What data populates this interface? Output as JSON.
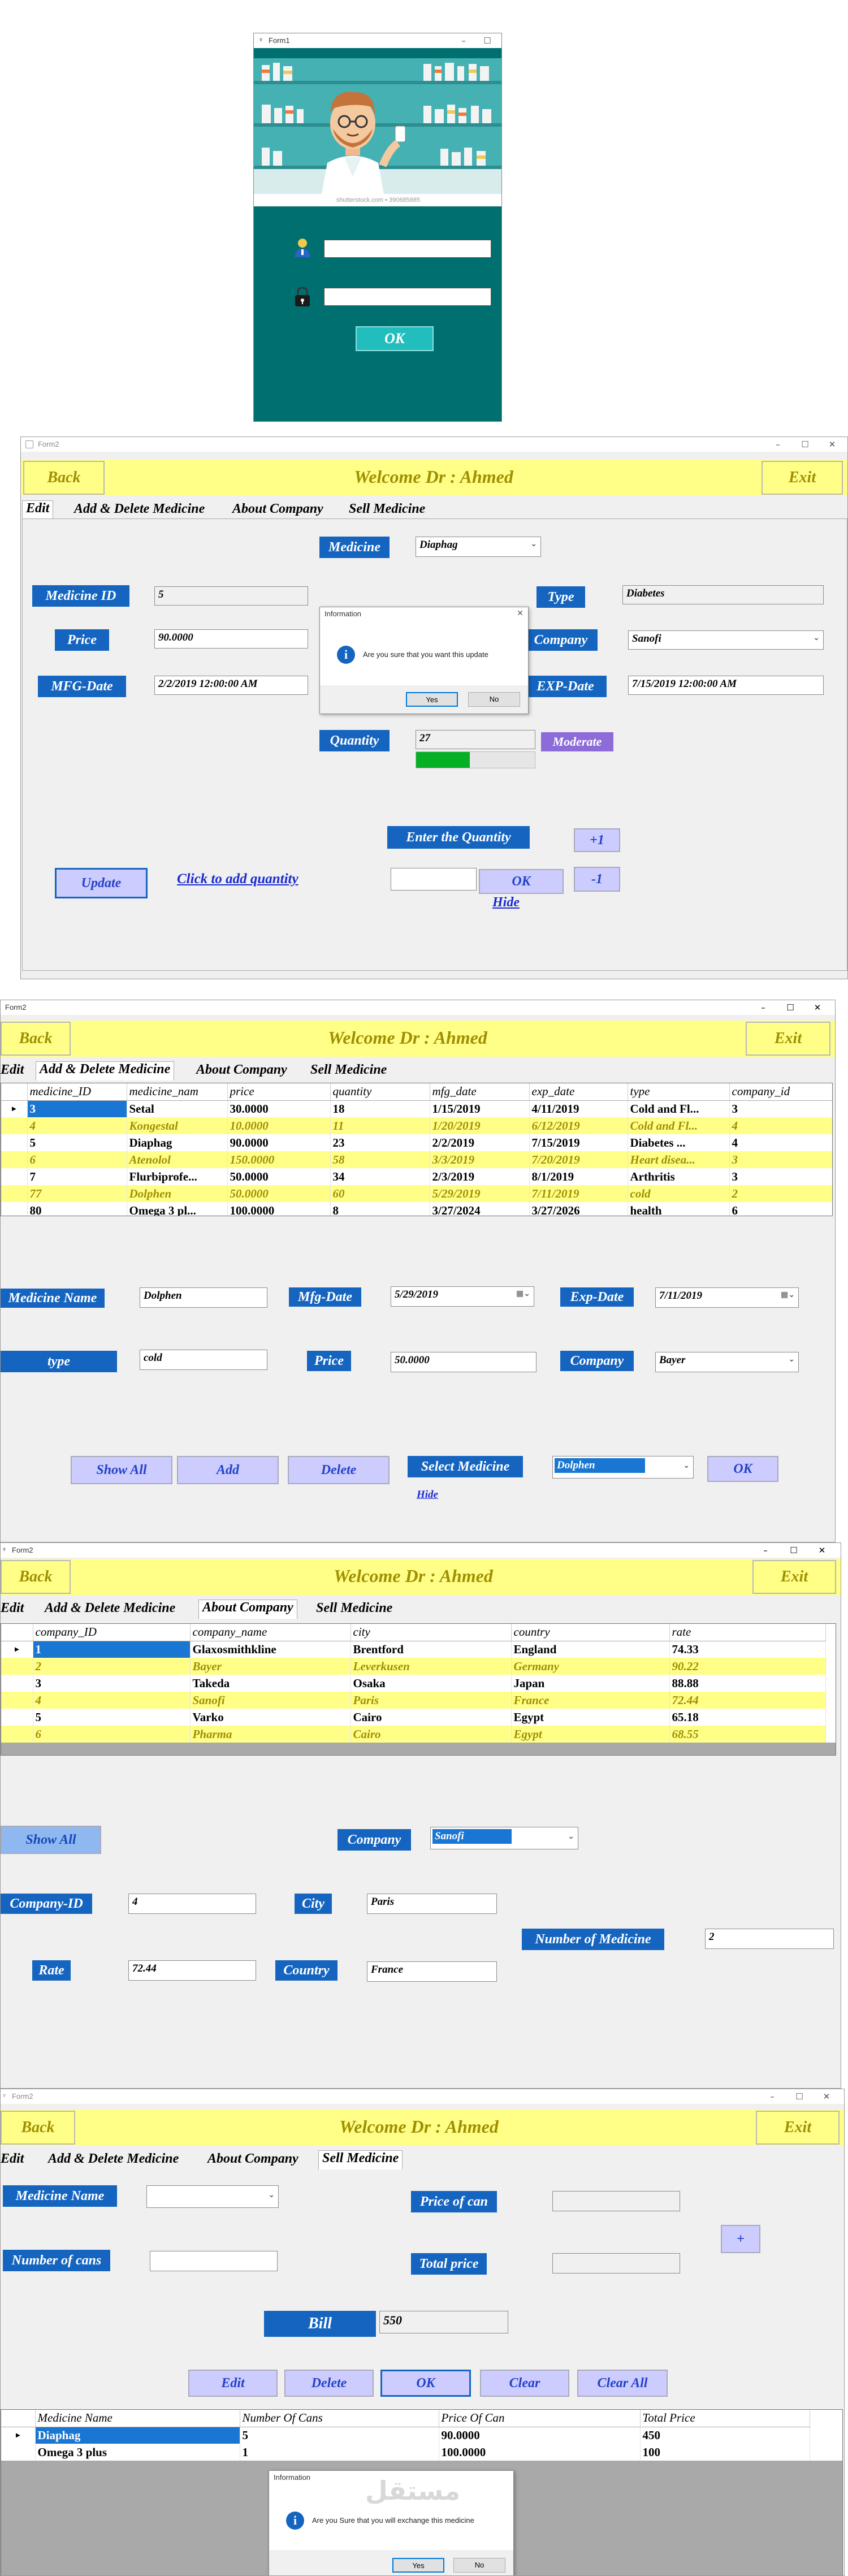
{
  "login": {
    "title": "Form1",
    "watermark": "shutterstock.com • 390685885",
    "ok_label": "OK"
  },
  "app": {
    "form_title": "Form2",
    "back_label": "Back",
    "exit_label": "Exit",
    "welcome": "Welcome Dr  : Ahmed",
    "tabs": [
      "Edit",
      "Add & Delete Medicine",
      "About Company",
      "Sell Medicine"
    ]
  },
  "edit": {
    "medicine_label": "Medicine",
    "medicine_value": "Diaphag",
    "medicine_id_label": "Medicine ID",
    "medicine_id_value": "5",
    "type_label": "Type",
    "type_value": "Diabetes",
    "price_label": "Price",
    "price_value": "90.0000",
    "company_label": "Company",
    "company_value": "Sanofi",
    "mfg_label": "MFG-Date",
    "mfg_value": "2/2/2019 12:00:00 AM",
    "exp_label": "EXP-Date",
    "exp_value": "7/15/2019 12:00:00 AM",
    "quantity_label": "Quantity",
    "quantity_value": "27",
    "quantity_status": "Moderate",
    "quantity_level": 0.45,
    "enter_quantity_label": "Enter the Quantity",
    "plus_label": "+1",
    "minus_label": "-1",
    "update_label": "Update",
    "click_add_label": "Click to add quantity",
    "ok_label": "OK",
    "hide_label": "Hide",
    "dialog": {
      "title": "Information",
      "message": "Are you sure that you want this update",
      "yes": "Yes",
      "no": "No"
    }
  },
  "adddel": {
    "columns": [
      "medicine_ID",
      "medicine_nam",
      "price",
      "quantity",
      "mfg_date",
      "exp_date",
      "type",
      "company_id"
    ],
    "rows": [
      [
        "3",
        "Setal",
        "30.0000",
        "18",
        "1/15/2019",
        "4/11/2019",
        "Cold and Fl...",
        "3"
      ],
      [
        "4",
        "Kongestal",
        "10.0000",
        "11",
        "1/20/2019",
        "6/12/2019",
        "Cold and Fl...",
        "4"
      ],
      [
        "5",
        "Diaphag",
        "90.0000",
        "23",
        "2/2/2019",
        "7/15/2019",
        "Diabetes     ...",
        "4"
      ],
      [
        "6",
        "Atenolol",
        "150.0000",
        "58",
        "3/3/2019",
        "7/20/2019",
        "Heart disea...",
        "3"
      ],
      [
        "7",
        "Flurbiprofe...",
        "50.0000",
        "34",
        "2/3/2019",
        "8/1/2019",
        "Arthritis",
        "3"
      ],
      [
        "77",
        "Dolphen",
        "50.0000",
        "60",
        "5/29/2019",
        "7/11/2019",
        "cold",
        "2"
      ],
      [
        "80",
        "Omega 3 pl...",
        "100.0000",
        "8",
        "3/27/2024",
        "3/27/2026",
        "health",
        "6"
      ]
    ],
    "medicine_name_label": "Medicine Name",
    "medicine_name_value": "Dolphen",
    "mfg_label": "Mfg-Date",
    "mfg_value": "5/29/2019",
    "exp_label": "Exp-Date",
    "exp_value": "7/11/2019",
    "type_label": "type",
    "type_value": "cold",
    "price_label": "Price",
    "price_value": "50.0000",
    "company_label": "Company",
    "company_value": "Bayer",
    "show_all_label": "Show All",
    "add_label": "Add",
    "delete_label": "Delete",
    "select_medicine_label": "Select Medicine",
    "select_medicine_value": "Dolphen",
    "ok_label": "OK",
    "hide_label": "Hide"
  },
  "company": {
    "columns": [
      "company_ID",
      "company_name",
      "city",
      "country",
      "rate"
    ],
    "rows": [
      [
        "1",
        "Glaxosmithkline",
        "Brentford",
        "England",
        "74.33"
      ],
      [
        "2",
        "Bayer",
        "Leverkusen",
        "Germany",
        "90.22"
      ],
      [
        "3",
        "Takeda",
        "Osaka",
        "Japan",
        "88.88"
      ],
      [
        "4",
        "Sanofi",
        "Paris",
        "France",
        "72.44"
      ],
      [
        "5",
        "Varko",
        "Cairo",
        "Egypt",
        "65.18"
      ],
      [
        "6",
        "Pharma",
        "Cairo",
        "Egypt",
        "68.55"
      ]
    ],
    "show_all_label": "Show All",
    "company_label": "Company",
    "company_value": "Sanofi",
    "company_id_label": "Company-ID",
    "company_id_value": "4",
    "city_label": "City",
    "city_value": "Paris",
    "num_medicine_label": "Number of Medicine",
    "num_medicine_value": "2",
    "rate_label": "Rate",
    "rate_value": "72.44",
    "country_label": "Country",
    "country_value": "France"
  },
  "sell": {
    "medicine_name_label": "Medicine Name",
    "price_of_can_label": "Price of can",
    "plus_label": "+",
    "number_of_cans_label": "Number of cans",
    "total_price_label": "Total price",
    "bill_label": "Bill",
    "bill_value": "550",
    "edit_label": "Edit",
    "delete_label": "Delete",
    "ok_label": "OK",
    "clear_label": "Clear",
    "clear_all_label": "Clear All",
    "columns": [
      "Medicine Name",
      "Number Of Cans",
      "Price Of Can",
      "Total Price"
    ],
    "rows": [
      [
        "Diaphag",
        "5",
        "90.0000",
        "450"
      ],
      [
        "Omega 3 plus",
        "1",
        "100.0000",
        "100"
      ]
    ],
    "dialog": {
      "title": "Information",
      "message": "Are you Sure that you will exchange this medicine",
      "yes": "Yes",
      "no": "No"
    },
    "watermark": "مستقل"
  }
}
